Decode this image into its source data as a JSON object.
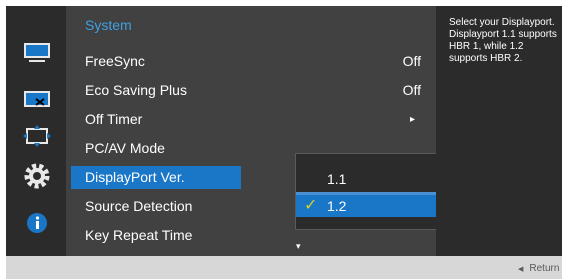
{
  "menu": {
    "header": "System",
    "items": [
      {
        "label": "FreeSync",
        "value": "Off"
      },
      {
        "label": "Eco Saving Plus",
        "value": "Off"
      },
      {
        "label": "Off Timer",
        "arrow": "▸"
      },
      {
        "label": "PC/AV Mode"
      },
      {
        "label": "DisplayPort Ver.",
        "selected": true
      },
      {
        "label": "Source Detection"
      },
      {
        "label": "Key Repeat Time"
      }
    ],
    "scroll_indicator": "▾"
  },
  "submenu": {
    "options": [
      {
        "label": "1.1"
      },
      {
        "label": "1.2",
        "checkmark": "✓",
        "selected": true
      }
    ]
  },
  "info": {
    "text": "Select your Displayport. Displayport 1.1 supports HBR 1, while 1.2 supports HBR 2."
  },
  "footer": {
    "return_label": "Return",
    "return_arrow": "◀"
  },
  "icons": [
    "picture-icon",
    "screen-adjust-icon",
    "onscreen-display-icon",
    "system-gear-icon",
    "information-icon"
  ],
  "colors": {
    "accent_blue": "#1a76c6",
    "header_blue": "#3ea0e3",
    "checkmark_yellow": "#d6d02f",
    "panel_dark": "#2b2b2b",
    "menu_gray": "#414141",
    "footer_gray": "#d7d7d7"
  }
}
